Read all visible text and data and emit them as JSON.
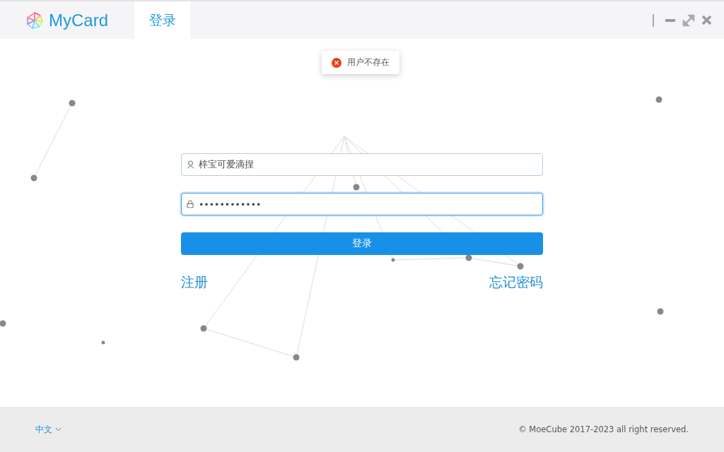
{
  "header": {
    "logo_text": "MyCard",
    "tabs": [
      {
        "label": "登录",
        "selected": true
      }
    ]
  },
  "toast": {
    "kind": "error",
    "message": "用户不存在"
  },
  "form": {
    "username": {
      "value": "梓宝可爱滴捏"
    },
    "password": {
      "value": "••••••••••••"
    },
    "submit": "登录",
    "register_link": "注册",
    "forgot_link": "忘记密码"
  },
  "footer": {
    "language": "中文",
    "copyright": "© MoeCube 2017-2023 all right reserved."
  }
}
